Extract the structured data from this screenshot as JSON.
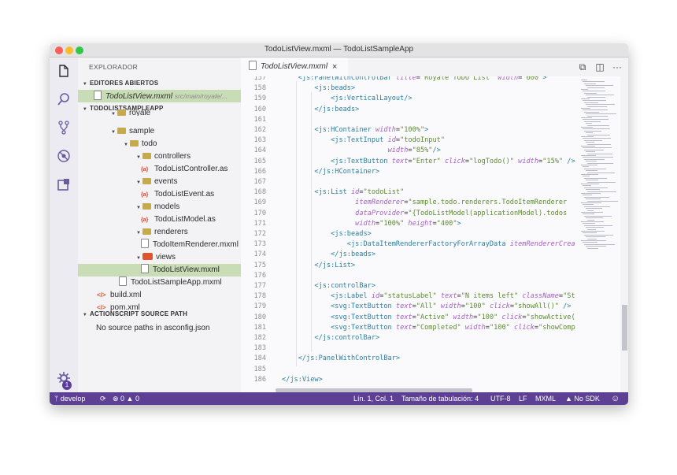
{
  "window": {
    "title": "TodoListView.mxml — TodoListSampleApp"
  },
  "activity_bar": {
    "icons": [
      "files-icon",
      "search-icon",
      "source-control-icon",
      "debug-icon",
      "extensions-icon",
      "gear-icon"
    ],
    "gear_badge": "1"
  },
  "sidebar": {
    "header": "EXPLORADOR",
    "open_editors_title": "EDITORES ABIERTOS",
    "open_editor": {
      "name": "TodoListView.mxml",
      "path": "src/main/royale/..."
    },
    "project_title": "TODOLISTSAMPLEAPP",
    "tree": [
      {
        "label": "royale",
        "kind": "folder"
      },
      {
        "label": "sample",
        "kind": "folder"
      },
      {
        "label": "todo",
        "kind": "folder"
      },
      {
        "label": "controllers",
        "kind": "folder"
      },
      {
        "label": "TodoListController.as",
        "kind": "as"
      },
      {
        "label": "events",
        "kind": "folder"
      },
      {
        "label": "TodoListEvent.as",
        "kind": "as"
      },
      {
        "label": "models",
        "kind": "folder"
      },
      {
        "label": "TodoListModel.as",
        "kind": "as"
      },
      {
        "label": "renderers",
        "kind": "folder"
      },
      {
        "label": "TodoItemRenderer.mxml",
        "kind": "file"
      },
      {
        "label": "views",
        "kind": "folder"
      },
      {
        "label": "TodoListView.mxml",
        "kind": "file"
      },
      {
        "label": "TodoListSampleApp.mxml",
        "kind": "file"
      },
      {
        "label": "build.xml",
        "kind": "xml"
      },
      {
        "label": "pom.xml",
        "kind": "xml"
      }
    ],
    "as_icon_text": "{a}",
    "xml_icon_text": "</>",
    "source_path_title": "ACTIONSCRIPT SOURCE PATH",
    "source_path_empty": "No source paths in asconfig.json"
  },
  "editor": {
    "tab_label": "TodoListView.mxml",
    "tab_close": "×",
    "actions": [
      "⧉",
      "◫",
      "···"
    ],
    "lines": [
      {
        "n": "157",
        "t": [
          [
            "pl",
            "    "
          ],
          [
            "tg",
            "<js:PanelWithControlBar "
          ],
          [
            "at",
            "title"
          ],
          [
            "pl",
            "="
          ],
          [
            "st",
            "\"Royale TODO List\" "
          ],
          [
            "at",
            "width"
          ],
          [
            "pl",
            "="
          ],
          [
            "st",
            "\"600\""
          ],
          [
            "tg",
            ">"
          ]
        ]
      },
      {
        "n": "158",
        "t": [
          [
            "pl",
            "        "
          ],
          [
            "tg",
            "<js:beads>"
          ]
        ]
      },
      {
        "n": "159",
        "t": [
          [
            "pl",
            "            "
          ],
          [
            "tg",
            "<js:VerticalLayout/>"
          ]
        ]
      },
      {
        "n": "160",
        "t": [
          [
            "pl",
            "        "
          ],
          [
            "tg",
            "</js:beads>"
          ]
        ]
      },
      {
        "n": "161",
        "t": []
      },
      {
        "n": "162",
        "t": [
          [
            "pl",
            "        "
          ],
          [
            "tg",
            "<js:HContainer "
          ],
          [
            "at",
            "width"
          ],
          [
            "pl",
            "="
          ],
          [
            "st",
            "\"100%\""
          ],
          [
            "tg",
            ">"
          ]
        ]
      },
      {
        "n": "163",
        "t": [
          [
            "pl",
            "            "
          ],
          [
            "tg",
            "<js:TextInput "
          ],
          [
            "at",
            "id"
          ],
          [
            "pl",
            "="
          ],
          [
            "st",
            "\"todoInput\""
          ]
        ]
      },
      {
        "n": "164",
        "t": [
          [
            "pl",
            "                          "
          ],
          [
            "at",
            "width"
          ],
          [
            "pl",
            "="
          ],
          [
            "st",
            "\"85%\""
          ],
          [
            "tg",
            "/>"
          ]
        ]
      },
      {
        "n": "165",
        "t": [
          [
            "pl",
            "            "
          ],
          [
            "tg",
            "<js:TextButton "
          ],
          [
            "at",
            "text"
          ],
          [
            "pl",
            "="
          ],
          [
            "st",
            "\"Enter\" "
          ],
          [
            "at",
            "click"
          ],
          [
            "pl",
            "="
          ],
          [
            "st",
            "\"logTodo()\" "
          ],
          [
            "at",
            "width"
          ],
          [
            "pl",
            "="
          ],
          [
            "st",
            "\"15%\" "
          ],
          [
            "tg",
            "/>"
          ]
        ]
      },
      {
        "n": "166",
        "t": [
          [
            "pl",
            "        "
          ],
          [
            "tg",
            "</js:HContainer>"
          ]
        ]
      },
      {
        "n": "167",
        "t": []
      },
      {
        "n": "168",
        "t": [
          [
            "pl",
            "        "
          ],
          [
            "tg",
            "<js:List "
          ],
          [
            "at",
            "id"
          ],
          [
            "pl",
            "="
          ],
          [
            "st",
            "\"todoList\""
          ]
        ]
      },
      {
        "n": "169",
        "t": [
          [
            "pl",
            "                  "
          ],
          [
            "at",
            "itemRenderer"
          ],
          [
            "pl",
            "="
          ],
          [
            "st",
            "\"sample.todo.renderers.TodoItemRenderer"
          ]
        ]
      },
      {
        "n": "170",
        "t": [
          [
            "pl",
            "                  "
          ],
          [
            "at",
            "dataProvider"
          ],
          [
            "pl",
            "="
          ],
          [
            "st",
            "\"{TodoListModel(applicationModel).todos"
          ]
        ]
      },
      {
        "n": "171",
        "t": [
          [
            "pl",
            "                  "
          ],
          [
            "at",
            "width"
          ],
          [
            "pl",
            "="
          ],
          [
            "st",
            "\"100%\" "
          ],
          [
            "at",
            "height"
          ],
          [
            "pl",
            "="
          ],
          [
            "st",
            "\"400\""
          ],
          [
            "tg",
            ">"
          ]
        ]
      },
      {
        "n": "172",
        "t": [
          [
            "pl",
            "            "
          ],
          [
            "tg",
            "<js:beads>"
          ]
        ]
      },
      {
        "n": "173",
        "t": [
          [
            "pl",
            "                "
          ],
          [
            "tg",
            "<js:DataItemRendererFactoryForArrayData "
          ],
          [
            "at",
            "itemRendererCrea"
          ]
        ]
      },
      {
        "n": "174",
        "t": [
          [
            "pl",
            "            "
          ],
          [
            "tg",
            "</js:beads>"
          ]
        ]
      },
      {
        "n": "175",
        "t": [
          [
            "pl",
            "        "
          ],
          [
            "tg",
            "</js:List>"
          ]
        ]
      },
      {
        "n": "176",
        "t": []
      },
      {
        "n": "177",
        "t": [
          [
            "pl",
            "        "
          ],
          [
            "tg",
            "<js:controlBar>"
          ]
        ]
      },
      {
        "n": "178",
        "t": [
          [
            "pl",
            "            "
          ],
          [
            "tg",
            "<js:Label "
          ],
          [
            "at",
            "id"
          ],
          [
            "pl",
            "="
          ],
          [
            "st",
            "\"statusLabel\" "
          ],
          [
            "at",
            "text"
          ],
          [
            "pl",
            "="
          ],
          [
            "st",
            "\"N items left\" "
          ],
          [
            "at",
            "className"
          ],
          [
            "pl",
            "="
          ],
          [
            "st",
            "\"St"
          ]
        ]
      },
      {
        "n": "179",
        "t": [
          [
            "pl",
            "            "
          ],
          [
            "tg",
            "<svg:TextButton "
          ],
          [
            "at",
            "text"
          ],
          [
            "pl",
            "="
          ],
          [
            "st",
            "\"All\" "
          ],
          [
            "at",
            "width"
          ],
          [
            "pl",
            "="
          ],
          [
            "st",
            "\"100\" "
          ],
          [
            "at",
            "click"
          ],
          [
            "pl",
            "="
          ],
          [
            "st",
            "\"showAll()\" "
          ],
          [
            "tg",
            "/>"
          ]
        ]
      },
      {
        "n": "180",
        "t": [
          [
            "pl",
            "            "
          ],
          [
            "tg",
            "<svg:TextButton "
          ],
          [
            "at",
            "text"
          ],
          [
            "pl",
            "="
          ],
          [
            "st",
            "\"Active\" "
          ],
          [
            "at",
            "width"
          ],
          [
            "pl",
            "="
          ],
          [
            "st",
            "\"100\" "
          ],
          [
            "at",
            "click"
          ],
          [
            "pl",
            "="
          ],
          [
            "st",
            "\"showActive("
          ]
        ]
      },
      {
        "n": "181",
        "t": [
          [
            "pl",
            "            "
          ],
          [
            "tg",
            "<svg:TextButton "
          ],
          [
            "at",
            "text"
          ],
          [
            "pl",
            "="
          ],
          [
            "st",
            "\"Completed\" "
          ],
          [
            "at",
            "width"
          ],
          [
            "pl",
            "="
          ],
          [
            "st",
            "\"100\" "
          ],
          [
            "at",
            "click"
          ],
          [
            "pl",
            "="
          ],
          [
            "st",
            "\"showComp"
          ]
        ]
      },
      {
        "n": "182",
        "t": [
          [
            "pl",
            "        "
          ],
          [
            "tg",
            "</js:controlBar>"
          ]
        ]
      },
      {
        "n": "183",
        "t": []
      },
      {
        "n": "184",
        "t": [
          [
            "pl",
            "    "
          ],
          [
            "tg",
            "</js:PanelWithControlBar>"
          ]
        ]
      },
      {
        "n": "185",
        "t": []
      },
      {
        "n": "186",
        "t": [
          [
            "tg",
            "</js:View>"
          ]
        ]
      }
    ]
  },
  "statusbar": {
    "branch": "develop",
    "sync_icon": "⟳",
    "problems": "⊗ 0 ▲ 0",
    "position": "Lín. 1, Col. 1",
    "tab_size": "Tamaño de tabulación: 4",
    "encoding": "UTF-8",
    "eol": "LF",
    "language": "MXML",
    "sdk": "▲ No SDK",
    "feedback_icon": "☺"
  },
  "colors": {
    "status_bar": "#5d3f94",
    "selection": "#c8ddb5",
    "tag": "#2b7fa0",
    "attr": "#a65fc9",
    "string": "#5d8a2f"
  }
}
